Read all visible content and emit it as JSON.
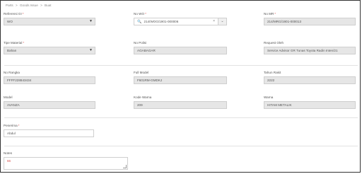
{
  "breadcrumb": [
    "Parts",
    ">",
    "Goods Issue",
    ">",
    "Buat"
  ],
  "form": {
    "referensi_gi": {
      "label": "Referensi GI",
      "value": "WO"
    },
    "no_wo": {
      "label": "No WO",
      "value": "214/WOG/1901-000006"
    },
    "no_mr": {
      "label": "No MR",
      "value": "214/MRG/1901-000013"
    },
    "tipe_material": {
      "label": "Tipe Material",
      "value": "Bahan"
    },
    "no_polisi": {
      "label": "No Polisi",
      "value": "AGABAGAR"
    },
    "request_oleh": {
      "label": "Request Oleh",
      "value": "Service Advisor GR Tunas Toyota Radin Inten/21"
    },
    "no_rangka": {
      "label": "No Rangka",
      "value": "FFFF228843434"
    },
    "full_model": {
      "label": "Full Model",
      "value": "F601RM-GMDKJ"
    },
    "tahun_rakit": {
      "label": "Tahun Rakit",
      "value": "2222"
    },
    "model": {
      "label": "Model",
      "value": "AVANZA"
    },
    "kode_warna": {
      "label": "Kode Warna",
      "value": "209"
    },
    "warna": {
      "label": "Warna",
      "value": "HITAM METALIK"
    },
    "penerima": {
      "label": "Penerima",
      "value": "Abdul"
    },
    "notes": {
      "label": "Notes",
      "value": "66"
    }
  },
  "required_mark": "*",
  "icons": {
    "caret": "caret-down-icon",
    "search": "search-icon",
    "clear": "clear-icon"
  },
  "colors": {
    "required": "#d9534f",
    "readonly_bg": "#e6e6e6",
    "border": "#cfcfcf"
  }
}
